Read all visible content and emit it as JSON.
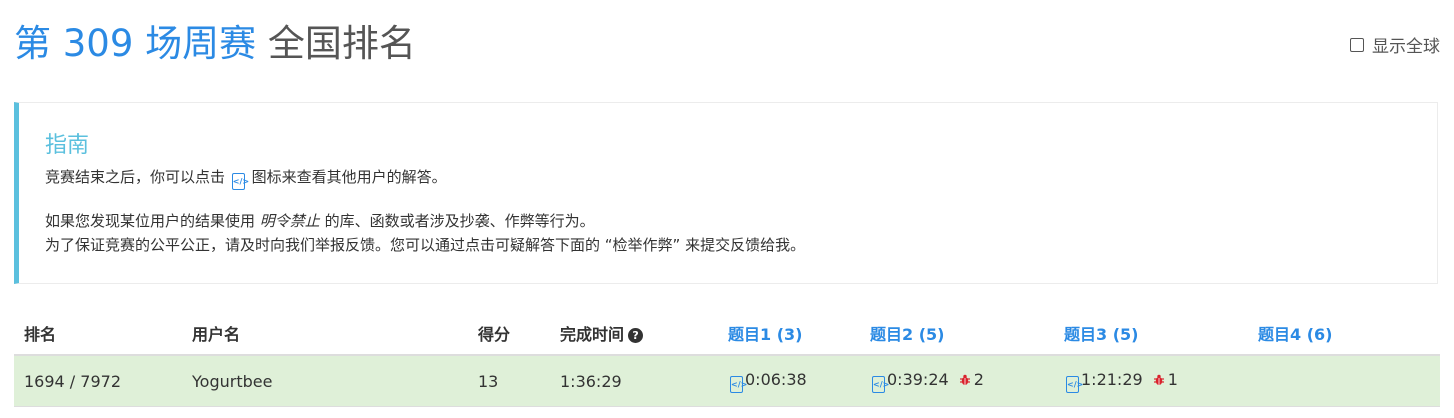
{
  "header": {
    "title_main": "第 309 场周赛",
    "title_sub": " 全国排名",
    "global_label": "显示全球"
  },
  "guide": {
    "heading": "指南",
    "line1_pre": "竞赛结束之后，你可以点击",
    "line1_post": "图标来查看其他用户的解答。",
    "line2_pre": "如果您发现某位用户的结果使用",
    "line2_em": "明令禁止",
    "line2_post": "的库、函数或者涉及抄袭、作弊等行为。",
    "line3": "为了保证竞赛的公平公正，请及时向我们举报反馈。您可以通过点击可疑解答下面的 “检举作弊” 来提交反馈给我。"
  },
  "table": {
    "headers": {
      "rank": "排名",
      "user": "用户名",
      "score": "得分",
      "time": "完成时间",
      "q1": "题目1 (3)",
      "q2": "题目2 (5)",
      "q3": "题目3 (5)",
      "q4": "题目4 (6)"
    },
    "row": {
      "rank": "1694 / 7972",
      "user": "Yogurtbee",
      "score": "13",
      "time": "1:36:29",
      "q1_time": "0:06:38",
      "q2_time": "0:39:24",
      "q2_bugs": "2",
      "q3_time": "1:21:29",
      "q3_bugs": "1"
    }
  },
  "colors": {
    "accent": "#2b8ae4",
    "guide_accent": "#5bc0de",
    "row_success": "#dff0d8",
    "bug": "#d9232d"
  },
  "icons": {
    "code": "code-file-icon",
    "bug": "bug-icon",
    "help": "question-circle-icon"
  }
}
